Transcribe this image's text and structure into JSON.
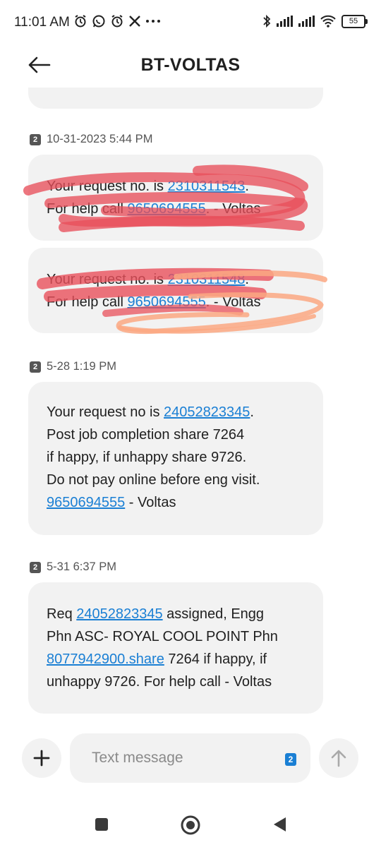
{
  "status_bar": {
    "time": "11:01 AM",
    "left_icons": [
      "alarm-icon",
      "whatsapp-icon",
      "alarm-icon",
      "x-icon",
      "more-dots-icon"
    ],
    "right_icons": [
      "bluetooth-icon",
      "signal-icon",
      "signal-icon",
      "wifi-icon",
      "battery-icon"
    ],
    "battery": "55"
  },
  "header": {
    "title": "BT-VOLTAS",
    "back_icon": "back-arrow-icon"
  },
  "messages": [
    {
      "date": "10-31-2023 5:44 PM",
      "sim": "2",
      "bubbles": [
        {
          "pre": "Your request no. is ",
          "link1": "2310311543",
          "mid": ".",
          "line2": "For help call ",
          "link2": "9650694555",
          "post": ". - Voltas"
        },
        {
          "pre": "Your request no. is ",
          "link1": "2310311548",
          "mid": ".",
          "line2": "For help call ",
          "link2": "9650694555",
          "post": ". - Voltas"
        }
      ]
    },
    {
      "date": "5-28 1:19 PM",
      "sim": "2",
      "bubble": {
        "t1": "Your request no is ",
        "link1": "24052823345",
        "t2": ".",
        "t3": "Post job completion share 7264",
        "t4": "if happy, if unhappy share 9726.",
        "t5": "Do not pay online before eng visit.",
        "link2": "9650694555",
        "t6": " - Voltas"
      }
    },
    {
      "date": "5-31 6:37 PM",
      "sim": "2",
      "bubble": {
        "t1": "Req ",
        "link1": "24052823345",
        "t2": " assigned, Engg",
        "t3": "Phn  ASC- ROYAL COOL POINT Phn",
        "link2": "8077942900.share",
        "t4": " 7264 if happy, if",
        "t5": "unhappy 9726. For help call - Voltas"
      }
    }
  ],
  "composer": {
    "placeholder": "Text message",
    "sim": "2",
    "add_icon": "plus-icon",
    "send_icon": "send-arrow-icon"
  },
  "nav_bar": {
    "icons": [
      "recents-square-icon",
      "home-circle-icon",
      "back-triangle-icon"
    ]
  },
  "colors": {
    "link": "#1a7fd4",
    "bubble": "#f2f2f2",
    "scribble_red": "#e8505b",
    "scribble_orange": "#fba882"
  }
}
